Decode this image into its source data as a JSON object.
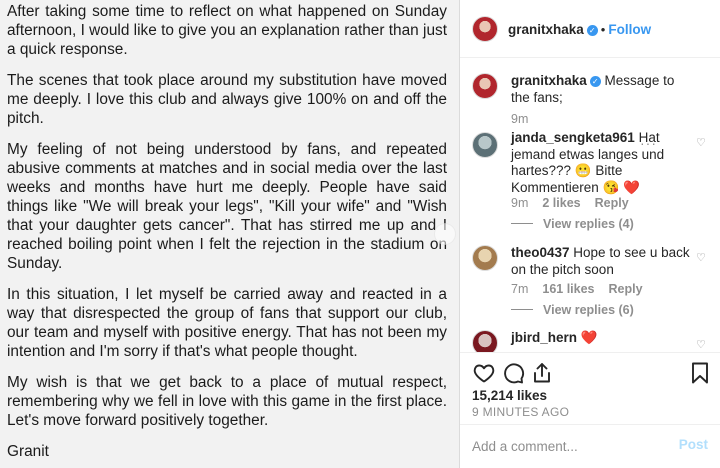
{
  "post_image": {
    "paragraphs": [
      "After taking some time to reflect on what happened on Sunday afternoon, I would like to give you an explanation rather than just a quick response.",
      "The scenes that took place around my substitution have moved me deeply. I love this club and always give 100% on and off the pitch.",
      "My feeling of not being understood by fans, and repeated abusive comments at matches and in social media over the last weeks and months have hurt me deeply. People have said things like \"We will break your legs\", \"Kill your wife\" and \"Wish that your daughter gets cancer\". That has stirred me up and I reached boiling point when I felt the rejection in the stadium on Sunday.",
      "In this situation, I let myself be carried away and reacted in a way that disrespected the group of fans that support our club, our team and myself with positive energy. That has not been my intention and I'm sorry if that's what people thought.",
      "My wish is that we get back to a place of mutual respect, remembering why we fell in love with this game in the first place. Let's move forward positively together.",
      "Granit"
    ]
  },
  "header": {
    "username": "granitxhaka",
    "separator": "•",
    "follow_label": "Follow"
  },
  "caption": {
    "username": "granitxhaka",
    "text": "Message to the fans;",
    "time": "9m"
  },
  "comments": [
    {
      "username": "janda_sengketa961",
      "text": "Hat jemand etwas langes und hartes??? 😬  Bitte Kommentieren 😘 ❤️",
      "time": "9m",
      "likes": "2 likes",
      "reply_label": "Reply",
      "view_replies": "View replies (4)"
    },
    {
      "username": "theo0437",
      "text": "Hope to see u back on the pitch soon",
      "time": "7m",
      "likes": "161 likes",
      "reply_label": "Reply",
      "view_replies": "View replies (6)"
    },
    {
      "username": "jbird_hern",
      "text": "❤️"
    }
  ],
  "actions": {
    "likes": "15,214 likes",
    "time_ago": "9 MINUTES AGO"
  },
  "add_comment": {
    "placeholder": "Add a comment...",
    "post_label": "Post"
  },
  "colors": {
    "accent": "#3897f0",
    "verified": "#3897f0",
    "muted": "#8e8e8e",
    "text": "#262626",
    "post_disabled": "#b2dffc"
  }
}
